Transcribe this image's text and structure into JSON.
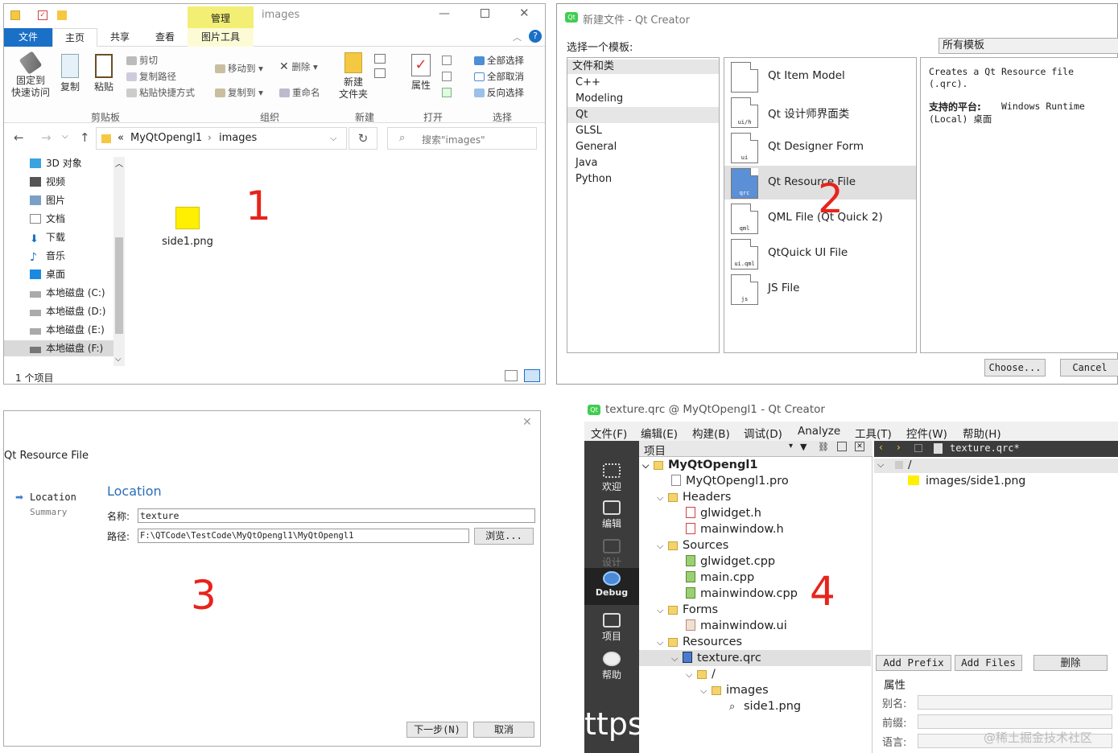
{
  "explorer": {
    "title": "images",
    "manage_tab": "管理",
    "tabs": [
      "文件",
      "主页",
      "共享",
      "查看",
      "图片工具"
    ],
    "ribbon": {
      "pin": "固定到\n快速访问",
      "pin_line1": "固定到",
      "pin_line2": "快速访问",
      "copy": "复制",
      "paste": "粘贴",
      "cut": "剪切",
      "copy_path": "复制路径",
      "paste_shortcut": "粘贴快捷方式",
      "move_to": "移动到",
      "copy_to": "复制到",
      "delete": "删除",
      "rename": "重命名",
      "new_folder_line1": "新建",
      "new_folder_line2": "文件夹",
      "properties": "属性",
      "select_all": "全部选择",
      "select_none": "全部取消",
      "invert_select": "反向选择",
      "groups": [
        "剪贴板",
        "组织",
        "新建",
        "打开",
        "选择"
      ]
    },
    "breadcrumb": [
      "«",
      "MyQtOpengl1",
      "images"
    ],
    "search_placeholder": "搜索\"images\"",
    "nav": [
      "3D 对象",
      "视频",
      "图片",
      "文档",
      "下载",
      "音乐",
      "桌面",
      "本地磁盘 (C:)",
      "本地磁盘 (D:)",
      "本地磁盘 (E:)",
      "本地磁盘 (F:)"
    ],
    "file_name": "side1.png",
    "status": "1 个项目",
    "number": "1"
  },
  "new_file": {
    "title": "新建文件 - Qt Creator",
    "choose_template": "选择一个模板:",
    "filter": "所有模板",
    "categories_header": "文件和类",
    "categories": [
      "C++",
      "Modeling",
      "Qt",
      "GLSL",
      "General",
      "Java",
      "Python"
    ],
    "templates": [
      {
        "label": "Qt Item Model",
        "icon": ""
      },
      {
        "label": "Qt 设计师界面类",
        "icon": "ui/h"
      },
      {
        "label": "Qt Designer Form",
        "icon": "ui"
      },
      {
        "label": "Qt Resource File",
        "icon": "qrc"
      },
      {
        "label": "QML File (Qt Quick 2)",
        "icon": "qml"
      },
      {
        "label": "QtQuick UI File",
        "icon": "ui.qml"
      },
      {
        "label": "JS File",
        "icon": "js"
      }
    ],
    "description_line1": "Creates a Qt Resource file",
    "description_line2": "(.qrc).",
    "platforms_label": "支持的平台:",
    "platforms_value1": "Windows Runtime",
    "platforms_value2": "(Local) 桌面",
    "choose_btn": "Choose...",
    "cancel_btn": "Cancel",
    "number": "2"
  },
  "wizard": {
    "title": "Qt Resource File",
    "steps": [
      "Location",
      "Summary"
    ],
    "heading": "Location",
    "name_label": "名称:",
    "name_value": "texture",
    "path_label": "路径:",
    "path_value": "F:\\QTCode\\TestCode\\MyQtOpengl1\\MyQtOpengl1",
    "browse_btn": "浏览...",
    "next_btn": "下一步(N)",
    "cancel_btn": "取消",
    "number": "3"
  },
  "creator": {
    "title": "texture.qrc @ MyQtOpengl1 - Qt Creator",
    "menus": [
      "文件(F)",
      "编辑(E)",
      "构建(B)",
      "调试(D)",
      "Analyze",
      "工具(T)",
      "控件(W)",
      "帮助(H)"
    ],
    "sidebar": [
      "欢迎",
      "编辑",
      "设计",
      "Debug",
      "项目",
      "帮助"
    ],
    "project_header": "项目",
    "editor_tab": "texture.qrc*",
    "tree": [
      {
        "label": "MyQtOpengl1",
        "level": 0,
        "arrow": "❯",
        "icon": "folder"
      },
      {
        "label": "MyQtOpengl1.pro",
        "level": 1,
        "arrow": "",
        "icon": "file"
      },
      {
        "label": "Headers",
        "level": 1,
        "arrow": "❯",
        "icon": "folder"
      },
      {
        "label": "glwidget.h",
        "level": 2,
        "arrow": "",
        "icon": "hdr"
      },
      {
        "label": "mainwindow.h",
        "level": 2,
        "arrow": "",
        "icon": "hdr"
      },
      {
        "label": "Sources",
        "level": 1,
        "arrow": "❯",
        "icon": "folder"
      },
      {
        "label": "glwidget.cpp",
        "level": 2,
        "arrow": "",
        "icon": "src"
      },
      {
        "label": "main.cpp",
        "level": 2,
        "arrow": "",
        "icon": "src"
      },
      {
        "label": "mainwindow.cpp",
        "level": 2,
        "arrow": "",
        "icon": "src"
      },
      {
        "label": "Forms",
        "level": 1,
        "arrow": "❯",
        "icon": "folder"
      },
      {
        "label": "mainwindow.ui",
        "level": 2,
        "arrow": "",
        "icon": "ui"
      },
      {
        "label": "Resources",
        "level": 1,
        "arrow": "❯",
        "icon": "folder"
      },
      {
        "label": "texture.qrc",
        "level": 2,
        "arrow": "❯",
        "icon": "qrc"
      },
      {
        "label": "/",
        "level": 3,
        "arrow": "❯",
        "icon": "folder"
      },
      {
        "label": "images",
        "level": 4,
        "arrow": "❯",
        "icon": "folder"
      },
      {
        "label": "side1.png",
        "level": 5,
        "arrow": "",
        "icon": "search"
      }
    ],
    "res_root": "/",
    "res_file": "images/side1.png",
    "add_prefix": "Add Prefix",
    "add_files": "Add Files",
    "delete_btn": "删除",
    "props_label": "属性",
    "alias_label": "别名:",
    "prefix_label": "前缀:",
    "lang_label": "语言:",
    "overlay_text": "ttps:",
    "watermark": "@稀土掘金技术社区",
    "number": "4"
  }
}
